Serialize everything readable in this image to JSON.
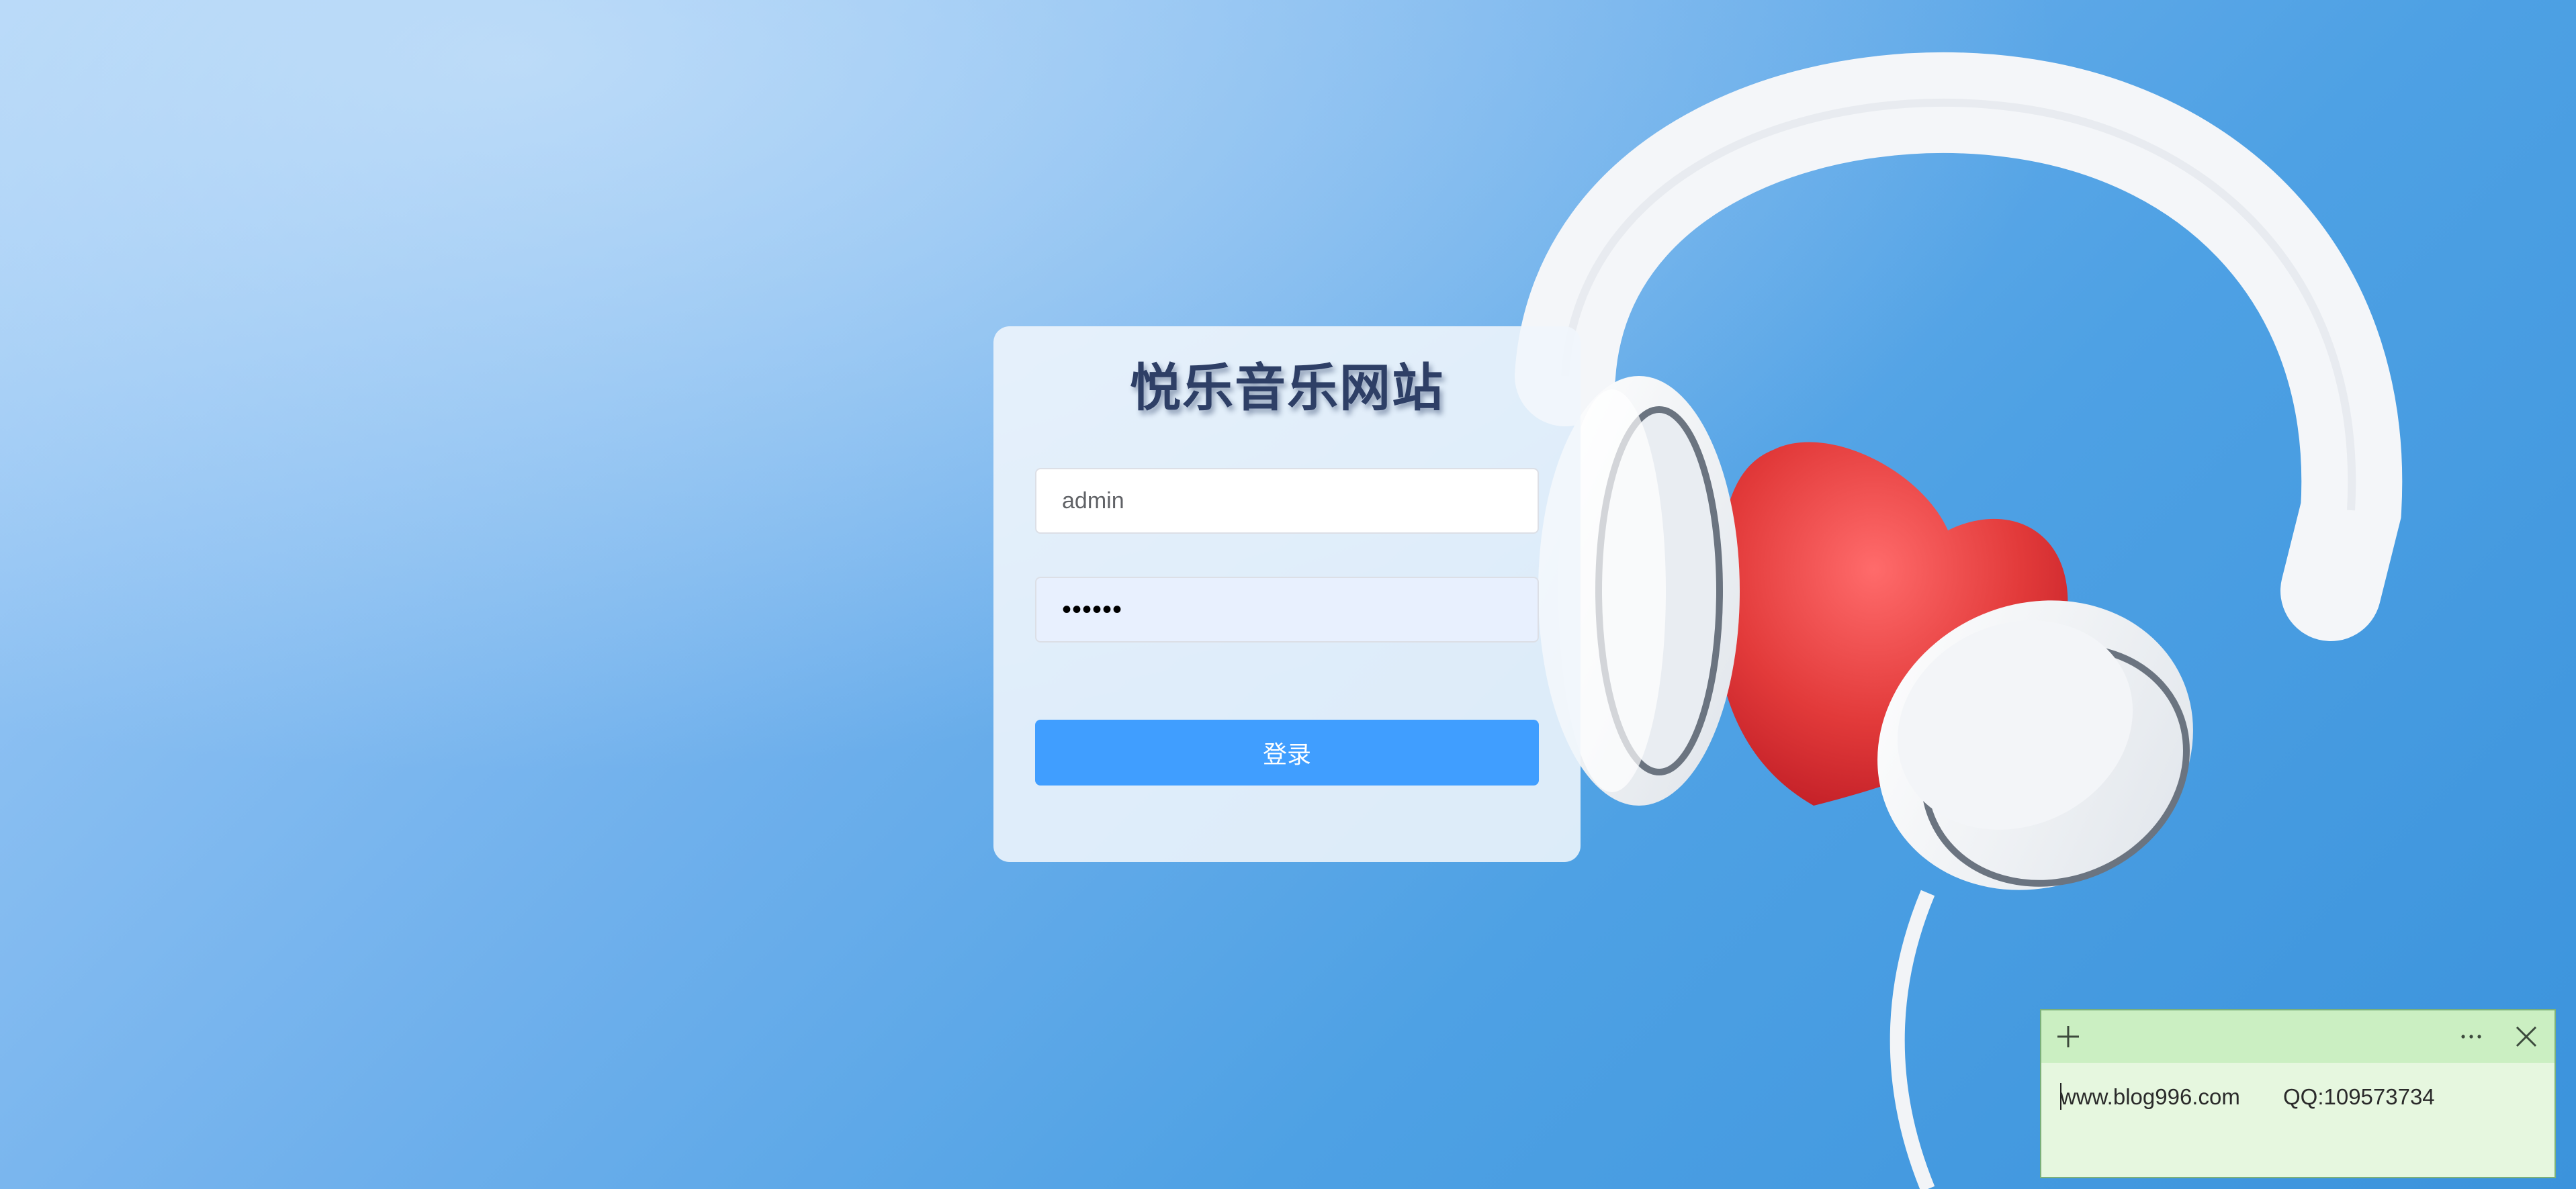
{
  "login": {
    "title": "悦乐音乐网站",
    "username_value": "admin",
    "password_value": "••••••",
    "submit_label": "登录"
  },
  "sticky_note": {
    "text": "www.blog996.com       QQ:109573734",
    "icons": {
      "add": "plus-icon",
      "menu": "more-horizontal-icon",
      "close": "close-icon"
    },
    "color": "#e6f7df"
  },
  "colors": {
    "primary_button": "#409eff",
    "title": "#2e3f66"
  }
}
